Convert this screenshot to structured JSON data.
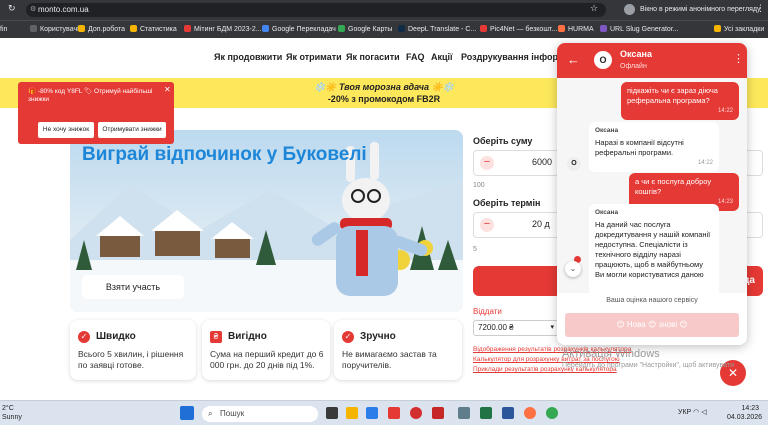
{
  "browser": {
    "url": "monto.com.ua",
    "incognito_label": "Вікно в режимі анонімного перегляду",
    "bookmarks": [
      {
        "label": "fin",
        "color": "#888888"
      },
      {
        "label": "Користувачі",
        "color": "#5f6368"
      },
      {
        "label": "Доп.робота",
        "color": "#f4b400"
      },
      {
        "label": "Статистика",
        "color": "#f4b400"
      },
      {
        "label": "Мітинг БДМ 2023-2...",
        "color": "#e53935"
      },
      {
        "label": "Google Перекладач",
        "color": "#4285f4"
      },
      {
        "label": "Google Карты",
        "color": "#34a853"
      },
      {
        "label": "DeepL Translate - С...",
        "color": "#0f2b46"
      },
      {
        "label": "Pic4Net — безкошт...",
        "color": "#e53935"
      },
      {
        "label": "HURMA",
        "color": "#ff7043"
      },
      {
        "label": "URL Slug Generator...",
        "color": "#7e57c2"
      },
      {
        "label": "Усі закладки",
        "color": "#f4b400"
      }
    ]
  },
  "site": {
    "nav": [
      "Як продовжити",
      "Як отримати",
      "Як погасити",
      "FAQ",
      "Акції",
      "Роздрукування інформації"
    ],
    "banner": {
      "line1": "❄️☀️ Твоя морозна вдача ☀️❄️",
      "line2": "-20% з промокодом FB2R"
    },
    "promo_popup": {
      "text": "🎁 -80% код Y8FL 🏷 Отримуй найбільші знижки",
      "decline": "Не хочу знижок",
      "accept": "Отримувати знижки"
    },
    "hero": {
      "title": "Виграй відпочинок у Буковелі",
      "button": "Взяти участь"
    },
    "calculator": {
      "sum_label": "Оберіть суму",
      "sum_value": "6000",
      "sum_min": "100",
      "term_label": "Оберіть термін",
      "term_value": "20 д",
      "term_min": "5",
      "submit": "Пода",
      "repay_label": "Віддати",
      "repay_value": "7200.00 ₴",
      "links": [
        "Відображення результатів розрахунків калькулятора",
        "Калькулятор для розрахунку витрат за послугою",
        "Приклади результатів розрахунку калькулятора"
      ]
    },
    "features": [
      {
        "title": "Швидко",
        "text": "Всього 5 хвилин, і рішення по заявці готове.",
        "icon": "clock-icon"
      },
      {
        "title": "Вигідно",
        "text": "Сума на перший кредит до 6 000 грн. до 20 днів під 1%.",
        "icon": "wallet-icon"
      },
      {
        "title": "Зручно",
        "text": "Не вимагаємо застав та поручителів.",
        "icon": "check-icon"
      }
    ]
  },
  "chat": {
    "agent_name": "Оксана",
    "agent_initial": "О",
    "status": "Офлайн",
    "messages": [
      {
        "from": "user",
        "text": "підкажіть чи є зараз діюча реферальна програма?",
        "time": "14:22"
      },
      {
        "from": "agent",
        "name": "Оксана",
        "text": "Наразі в компанії відсутні реферальні програми.",
        "time": "14:22"
      },
      {
        "from": "user",
        "text": "а чи є послуга доброу кошгів?",
        "time": "14:23"
      },
      {
        "from": "agent",
        "name": "Оксана",
        "text": "На даний час послуга докредитування у нашій компанії недоступна. Спеціалісти із технічного відділу наразі працюють, щоб в майбутньому Ви могли користуватися даною",
        "time": ""
      }
    ],
    "rating_label": "Ваша оцінка нашого сервісу",
    "rating_text": "😊 Нова 😊 знові 😊"
  },
  "watermark": {
    "line1": "Активація Windows",
    "line2": "Перейдіть до програми \"Настройки\", щоб активувати"
  },
  "taskbar": {
    "temp": "2°C",
    "weather": "Sunny",
    "search_placeholder": "Пошук",
    "lang": "УКР",
    "time": "14:23",
    "date": "04.03.2026"
  },
  "colors": {
    "accent": "#e53935",
    "banner": "#fde85b",
    "hero_title": "#1d86d8"
  }
}
